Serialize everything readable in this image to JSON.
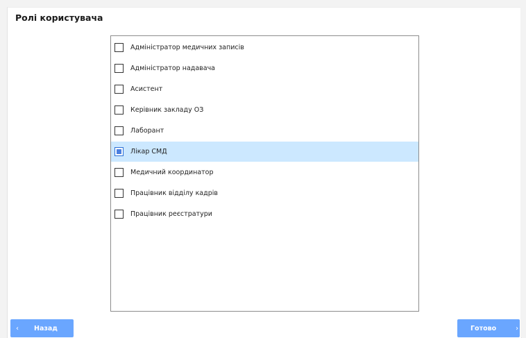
{
  "section": {
    "title": "Ролі користувача"
  },
  "roles": [
    {
      "label": "Адміністратор медичних записів",
      "checked": false
    },
    {
      "label": "Адміністратор надавача",
      "checked": false
    },
    {
      "label": "Асистент",
      "checked": false
    },
    {
      "label": "Керівник закладу ОЗ",
      "checked": false
    },
    {
      "label": "Лаборант",
      "checked": false
    },
    {
      "label": "Лікар СМД",
      "checked": true
    },
    {
      "label": "Медичний координатор",
      "checked": false
    },
    {
      "label": "Працівник відділу кадрів",
      "checked": false
    },
    {
      "label": "Працівник реєстратури",
      "checked": false
    }
  ],
  "footer": {
    "back_label": "Назад",
    "back_icon": "‹",
    "done_label": "Готово",
    "done_icon": "›"
  },
  "colors": {
    "accent": "#6aa6ff",
    "selected_row": "#cce8ff"
  }
}
